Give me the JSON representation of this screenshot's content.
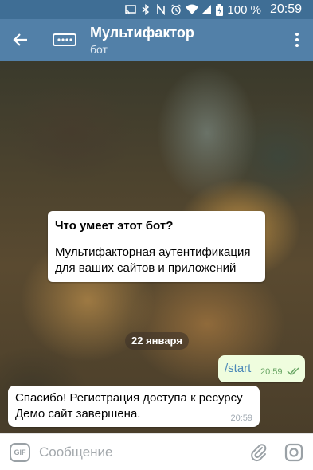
{
  "status_bar": {
    "battery_percent": "100 %",
    "time": "20:59",
    "icons": [
      "cast-icon",
      "bluetooth-icon",
      "nfc-icon",
      "alarm-icon",
      "wifi-icon",
      "signal-icon",
      "battery-icon"
    ]
  },
  "header": {
    "title": "Мультифактор",
    "subtitle": "бот",
    "icons": [
      "back-arrow-icon",
      "bot-avatar-icon",
      "more-vert-icon"
    ]
  },
  "chat": {
    "bot_info": {
      "title": "Что умеет этот бот?",
      "description": "Мультифакторная аутентификация\nдля ваших сайтов и приложений"
    },
    "date_separator": "22 января",
    "messages": [
      {
        "direction": "out",
        "text": "/start",
        "time": "20:59",
        "status": "read"
      },
      {
        "direction": "in",
        "text": "Спасибо! Регистрация доступа к ресурсу\nДемо сайт завершена.",
        "time": "20:59"
      }
    ]
  },
  "input_bar": {
    "gif_label": "GIF",
    "placeholder": "Сообщение",
    "value": ""
  },
  "colors": {
    "header": "#5280a8",
    "status_bar": "#3f6e95",
    "outgoing_bubble": "#effdde",
    "incoming_bubble": "#ffffff"
  }
}
